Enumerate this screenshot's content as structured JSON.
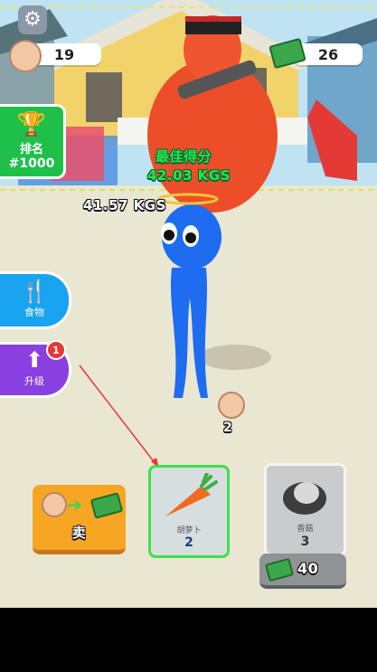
{
  "hud": {
    "strength_count": "19",
    "money_count": "26"
  },
  "rank": {
    "label": "排名",
    "value": "#1000"
  },
  "food_button": {
    "label": "食物"
  },
  "upgrade_button": {
    "label": "升级",
    "badge": "1"
  },
  "weights": {
    "best_label": "最佳得分",
    "best_value": "42.03 KGS",
    "current_value": "41.57 KGS"
  },
  "floor_item": {
    "count": "2"
  },
  "sell_button": {
    "label": "卖"
  },
  "food_cards": [
    {
      "name": "胡萝卜",
      "count": "2",
      "selected": true
    },
    {
      "name": "香菇",
      "count": "3",
      "selected": false,
      "price": "40"
    }
  ],
  "colors": {
    "accent_green": "#2ee34a",
    "food_blue": "#1aa3f0",
    "upgrade_purple": "#8a3fe0",
    "rank_green": "#1ec04a",
    "sell_orange": "#f6a623"
  }
}
